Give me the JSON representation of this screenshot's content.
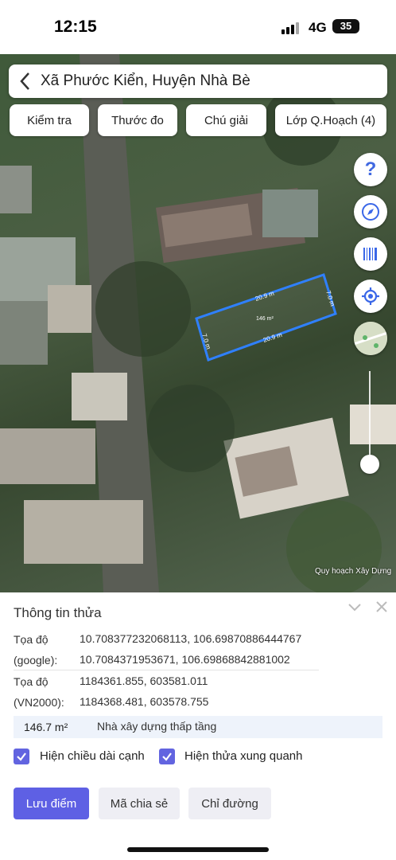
{
  "status_bar": {
    "time": "12:15",
    "network": "4G",
    "battery": "35"
  },
  "header": {
    "title": "Xã Phước Kiển, Huyện Nhà Bè"
  },
  "toolbar": {
    "chips": [
      "Kiểm tra",
      "Thước đo",
      "Chú giải",
      "Lớp Q.Hoạch (4)"
    ]
  },
  "map": {
    "parcel": {
      "side_long": "20.9 m",
      "side_short": "7.0 m",
      "area": "146 m²"
    },
    "attribution": "Quy hoạch Xây Dựng",
    "accent_color": "#2f80ff"
  },
  "side_buttons": [
    "help-icon",
    "compass-icon",
    "barcode-icon",
    "locate-icon",
    "map-thumbnail-icon"
  ],
  "panel": {
    "title": "Thông tin thửa",
    "rows": [
      {
        "label": "Tọa độ",
        "value": "10.708377232068113, 106.69870886444767"
      },
      {
        "label": "(google):",
        "value": "10.7084371953671, 106.69868842881002"
      },
      {
        "label": "Tọa độ",
        "value": "1184361.855, 603581.011"
      },
      {
        "label": "(VN2000):",
        "value": "1184368.481, 603578.755"
      }
    ],
    "area_value": "146.7 m²",
    "area_desc": "Nhà xây dựng thấp tầng",
    "checkboxes": [
      {
        "label": "Hiện chiều dài cạnh",
        "checked": true
      },
      {
        "label": "Hiện thửa xung quanh",
        "checked": true
      }
    ],
    "buttons": {
      "save": "Lưu điểm",
      "share": "Mã chia sẻ",
      "directions": "Chỉ đường"
    }
  },
  "colors": {
    "primary": "#5e60e4",
    "area_bg": "#eef3fb"
  }
}
